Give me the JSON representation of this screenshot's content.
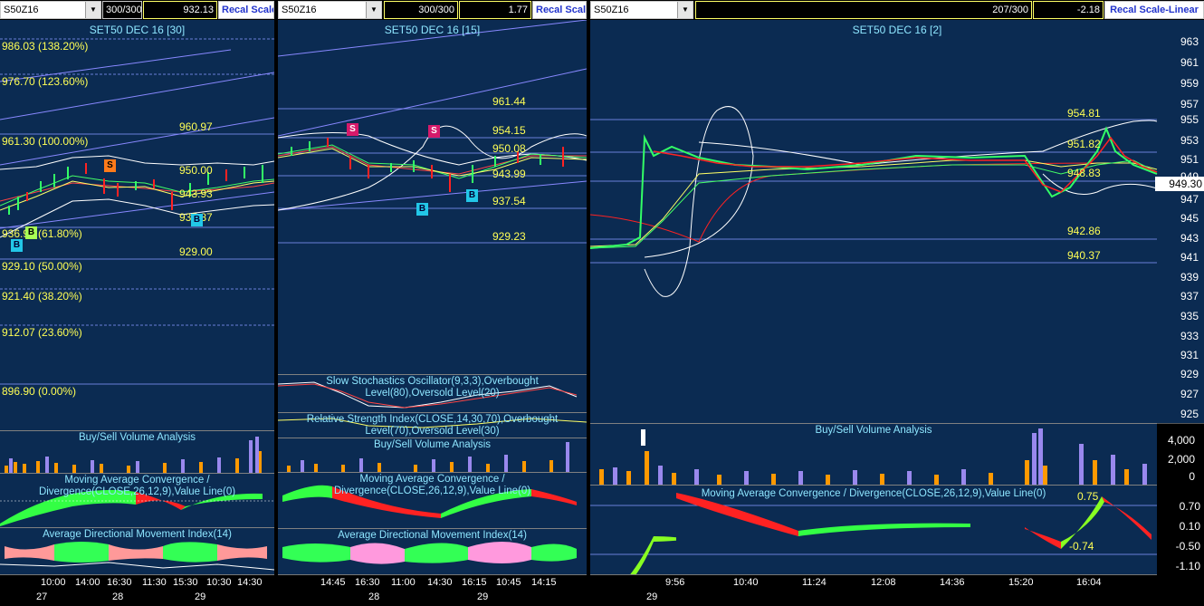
{
  "panels": [
    {
      "symbol": "S50Z16",
      "bars": "300/300",
      "value": "932.13",
      "recal": "Recal Scale",
      "title": "SET50 DEC 16  [30]",
      "levels": [
        "986.03 (138.20%)",
        "976.70 (123.60%)",
        "961.30 (100.00%)",
        "936.93 (61.80%)",
        "929.10 (50.00%)",
        "921.40 (38.20%)",
        "912.07 (23.60%)",
        "896.90 (0.00%)"
      ],
      "prices": [
        "960.97",
        "950.00",
        "943.93",
        "937.87",
        "929.00"
      ],
      "markers": [
        "S",
        "B",
        "B",
        "B"
      ],
      "sub_titles": [
        "Buy/Sell Volume Analysis",
        "Moving Average Convergence / Divergence(CLOSE,26,12,9),Value Line(0)",
        "Average Directional Movement Index(14)"
      ],
      "times": [
        "10:00",
        "14:00",
        "16:30",
        "11:30",
        "15:30",
        "10:30",
        "14:30"
      ],
      "dates": [
        "27",
        "28",
        "29"
      ]
    },
    {
      "symbol": "S50Z16",
      "bars": "300/300",
      "value": "1.77",
      "recal": "Recal Scale",
      "title": "SET50 DEC 16  [15]",
      "prices": [
        "961.44",
        "954.15",
        "950.08",
        "943.99",
        "937.54",
        "929.23"
      ],
      "markers": [
        "S",
        "S",
        "B",
        "B"
      ],
      "sub_titles": [
        "Slow Stochastics Oscillator(9,3,3),Overbought Level(80),Oversold Level(20)",
        "Relative Strength Index(CLOSE,14,30,70),Overbought Level(70),Oversold Level(30)",
        "Buy/Sell Volume Analysis",
        "Moving Average Convergence / Divergence(CLOSE,26,12,9),Value Line(0)",
        "Average Directional Movement Index(14)"
      ],
      "times": [
        "14:45",
        "16:30",
        "11:00",
        "14:30",
        "16:15",
        "10:45",
        "14:15"
      ],
      "dates": [
        "28",
        "29"
      ]
    },
    {
      "symbol": "S50Z16",
      "bars": "207/300",
      "value": "-2.18",
      "recal": "Recal Scale-Linear",
      "title": "SET50 DEC 16  [2]",
      "prices": [
        "954.81",
        "951.82",
        "948.83",
        "942.86",
        "940.37"
      ],
      "last_price": "949.30",
      "y_axis": [
        "963",
        "961",
        "959",
        "957",
        "955",
        "953",
        "951",
        "949",
        "947",
        "945",
        "943",
        "941",
        "939",
        "937",
        "935",
        "933",
        "931",
        "929",
        "927",
        "925"
      ],
      "sub_titles": [
        "Buy/Sell Volume Analysis",
        "Moving Average Convergence / Divergence(CLOSE,26,12,9),Value Line(0)"
      ],
      "vol_axis": [
        "4,000",
        "2,000",
        "0"
      ],
      "macd_axis": [
        "0.70",
        "0.10",
        "-0.50",
        "-1.10"
      ],
      "macd_labels": [
        "0.75",
        "-0.74"
      ],
      "times": [
        "9:56",
        "10:40",
        "11:24",
        "12:08",
        "14:36",
        "15:20",
        "16:04"
      ],
      "dates": [
        "29"
      ]
    }
  ],
  "colors": {
    "chart_bg": "#0b2b52",
    "level_text": "#ffff55",
    "title": "#8ee6ff",
    "bull": "#33ff66",
    "bear": "#ff2222"
  }
}
